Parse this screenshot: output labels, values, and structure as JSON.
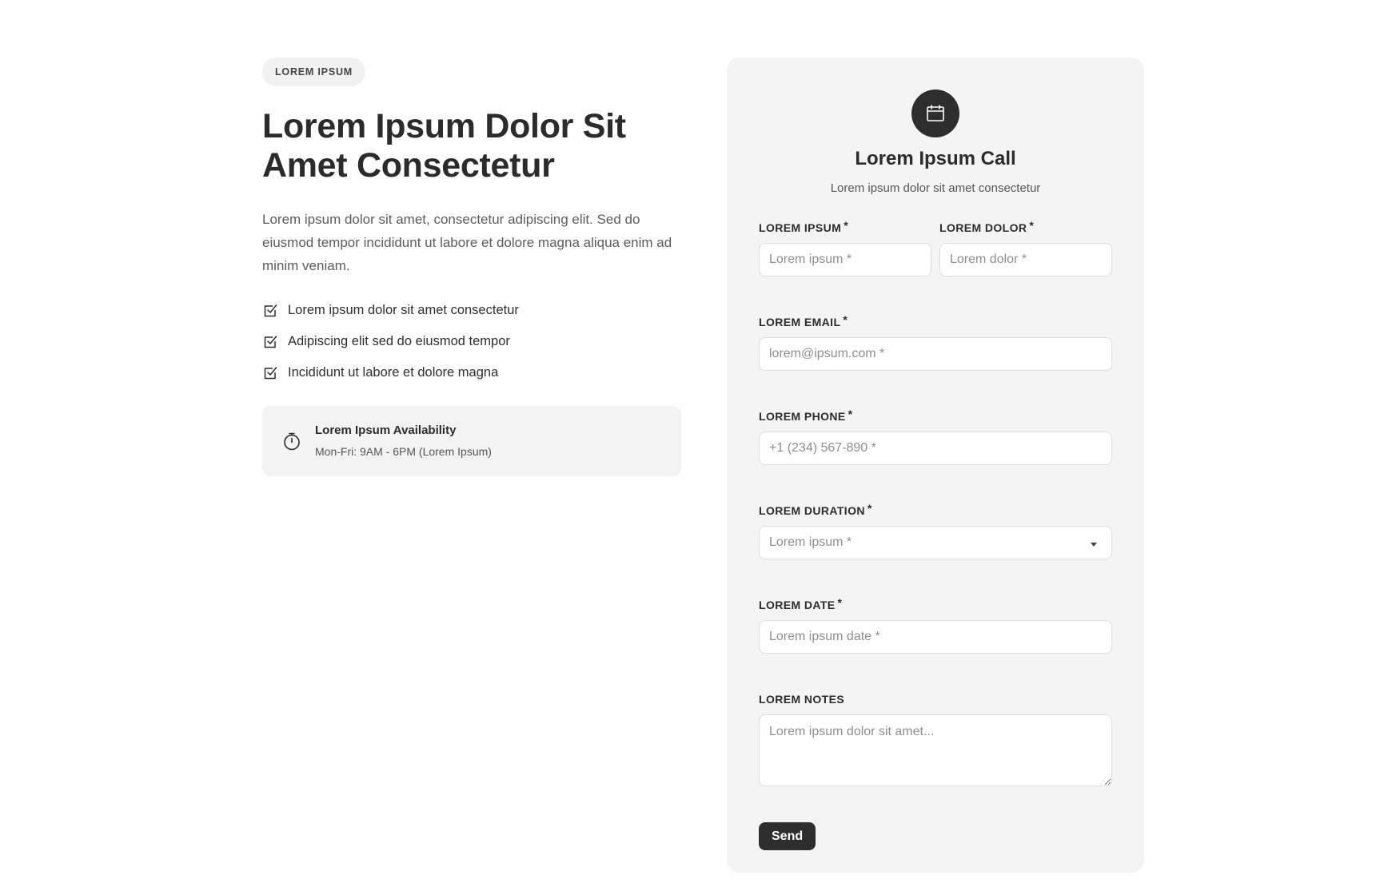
{
  "intro": {
    "badge": "LOREM IPSUM",
    "headline": "Lorem Ipsum Dolor Sit Amet Consectetur",
    "lead": "Lorem ipsum dolor sit amet, consectetur adipiscing elit. Sed do eiusmod tempor incididunt ut labore et dolore magna aliqua enim ad minim veniam.",
    "checklist": [
      "Lorem ipsum dolor sit amet consectetur",
      "Adipiscing elit sed do eiusmod tempor",
      "Incididunt ut labore et dolore magna"
    ],
    "availability": {
      "title": "Lorem Ipsum Availability",
      "hours": "Mon-Fri: 9AM - 6PM (Lorem Ipsum)"
    }
  },
  "form": {
    "title": "Lorem Ipsum Call",
    "subtitle": "Lorem ipsum dolor sit amet consectetur",
    "required_mark": "*",
    "fields": {
      "first": {
        "label": "LOREM IPSUM",
        "placeholder": "Lorem ipsum *"
      },
      "last": {
        "label": "LOREM DOLOR",
        "placeholder": "Lorem dolor *"
      },
      "email": {
        "label": "LOREM EMAIL",
        "placeholder": "lorem@ipsum.com *"
      },
      "phone": {
        "label": "LOREM PHONE",
        "placeholder": "+1 (234) 567-890 *"
      },
      "duration": {
        "label": "LOREM DURATION",
        "placeholder": "Lorem ipsum *"
      },
      "date": {
        "label": "LOREM DATE",
        "placeholder": "Lorem ipsum date *"
      },
      "notes": {
        "label": "LOREM NOTES",
        "placeholder": "Lorem ipsum dolor sit amet..."
      }
    },
    "submit_label": "Send"
  },
  "colors": {
    "accent": "#2e2e2e",
    "card_bg": "#f4f4f4",
    "badge_bg": "#f1f1f1"
  },
  "icons": {
    "badge_icon": "calendar-icon",
    "check_icon": "checkbox-checked-icon",
    "availability_icon": "stopwatch-icon"
  }
}
